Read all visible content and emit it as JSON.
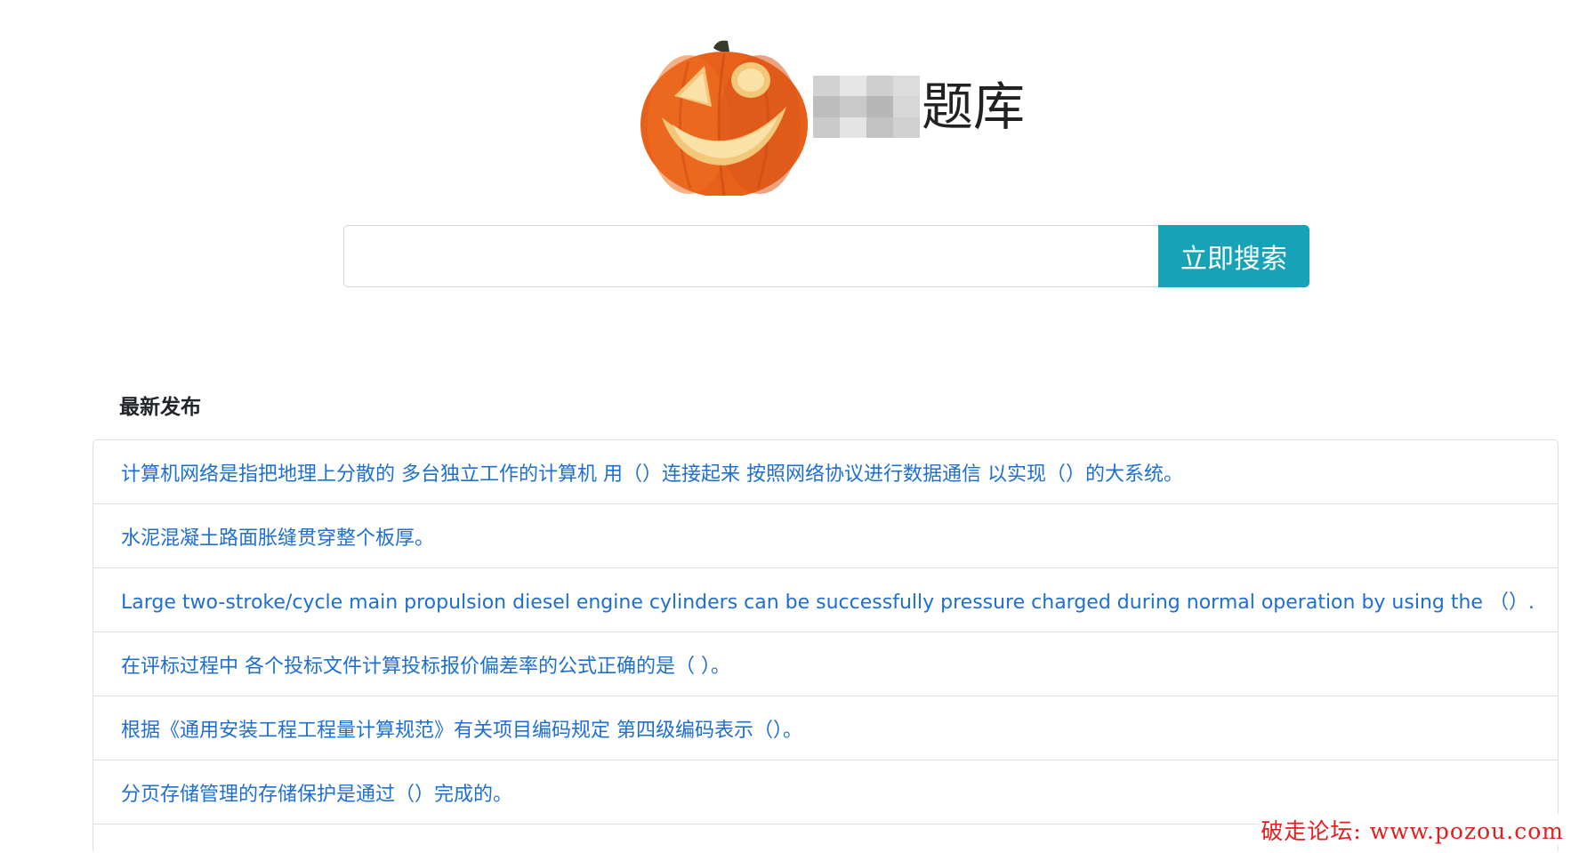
{
  "header": {
    "site_title": "题库",
    "logo_icon": "jack-o-lantern-pumpkin-icon"
  },
  "search": {
    "input_value": "",
    "button_label": "立即搜索"
  },
  "latest": {
    "title": "最新发布",
    "items": [
      {
        "text": "计算机网络是指把地理上分散的 多台独立工作的计算机 用（）连接起来 按照网络协议进行数据通信 以实现（）的大系统。"
      },
      {
        "text": "水泥混凝土路面胀缝贯穿整个板厚。"
      },
      {
        "text": "Large two-stroke/cycle main propulsion diesel engine cylinders can be successfully pressure charged during normal operation by using the （）."
      },
      {
        "text": "在评标过程中 各个投标文件计算投标报价偏差率的公式正确的是（ ）。"
      },
      {
        "text": "根据《通用安装工程工程量计算规范》有关项目编码规定 第四级编码表示（）。"
      },
      {
        "text": "分页存储管理的存储保护是通过（）完成的。"
      }
    ]
  },
  "watermark": {
    "text": "破走论坛: www.pozou.com"
  },
  "colors": {
    "accent": "#17a2b8",
    "link": "#1e6fd0",
    "watermark": "#e81c1c"
  }
}
